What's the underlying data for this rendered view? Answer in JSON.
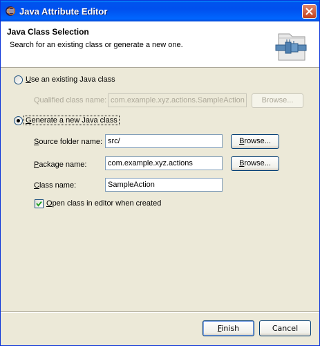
{
  "window": {
    "title": "Java Attribute Editor",
    "title_icon": "eclipse-icon",
    "close_icon": "close-icon"
  },
  "banner": {
    "title": "Java Class Selection",
    "description": "Search for an existing class or generate a new one.",
    "art_icon": "java-class-wizard-icon"
  },
  "existing": {
    "radio_label": "Use an existing Java class",
    "radio_checked": false,
    "qualified_label": "Qualified class name:",
    "qualified_value": "com.example.xyz.actions.SampleAction",
    "browse_label": "Browse..."
  },
  "generate": {
    "radio_label": "Generate a new Java class",
    "radio_checked": true,
    "source_folder_label": "Source folder name:",
    "source_folder_value": "src/",
    "source_browse_label": "Browse...",
    "package_label": "Package name:",
    "package_value": "com.example.xyz.actions",
    "package_browse_label": "Browse...",
    "class_label": "Class name:",
    "class_value": "SampleAction",
    "open_editor_label": "Open class in editor when created",
    "open_editor_checked": true
  },
  "buttons": {
    "finish": "Finish",
    "cancel": "Cancel"
  }
}
